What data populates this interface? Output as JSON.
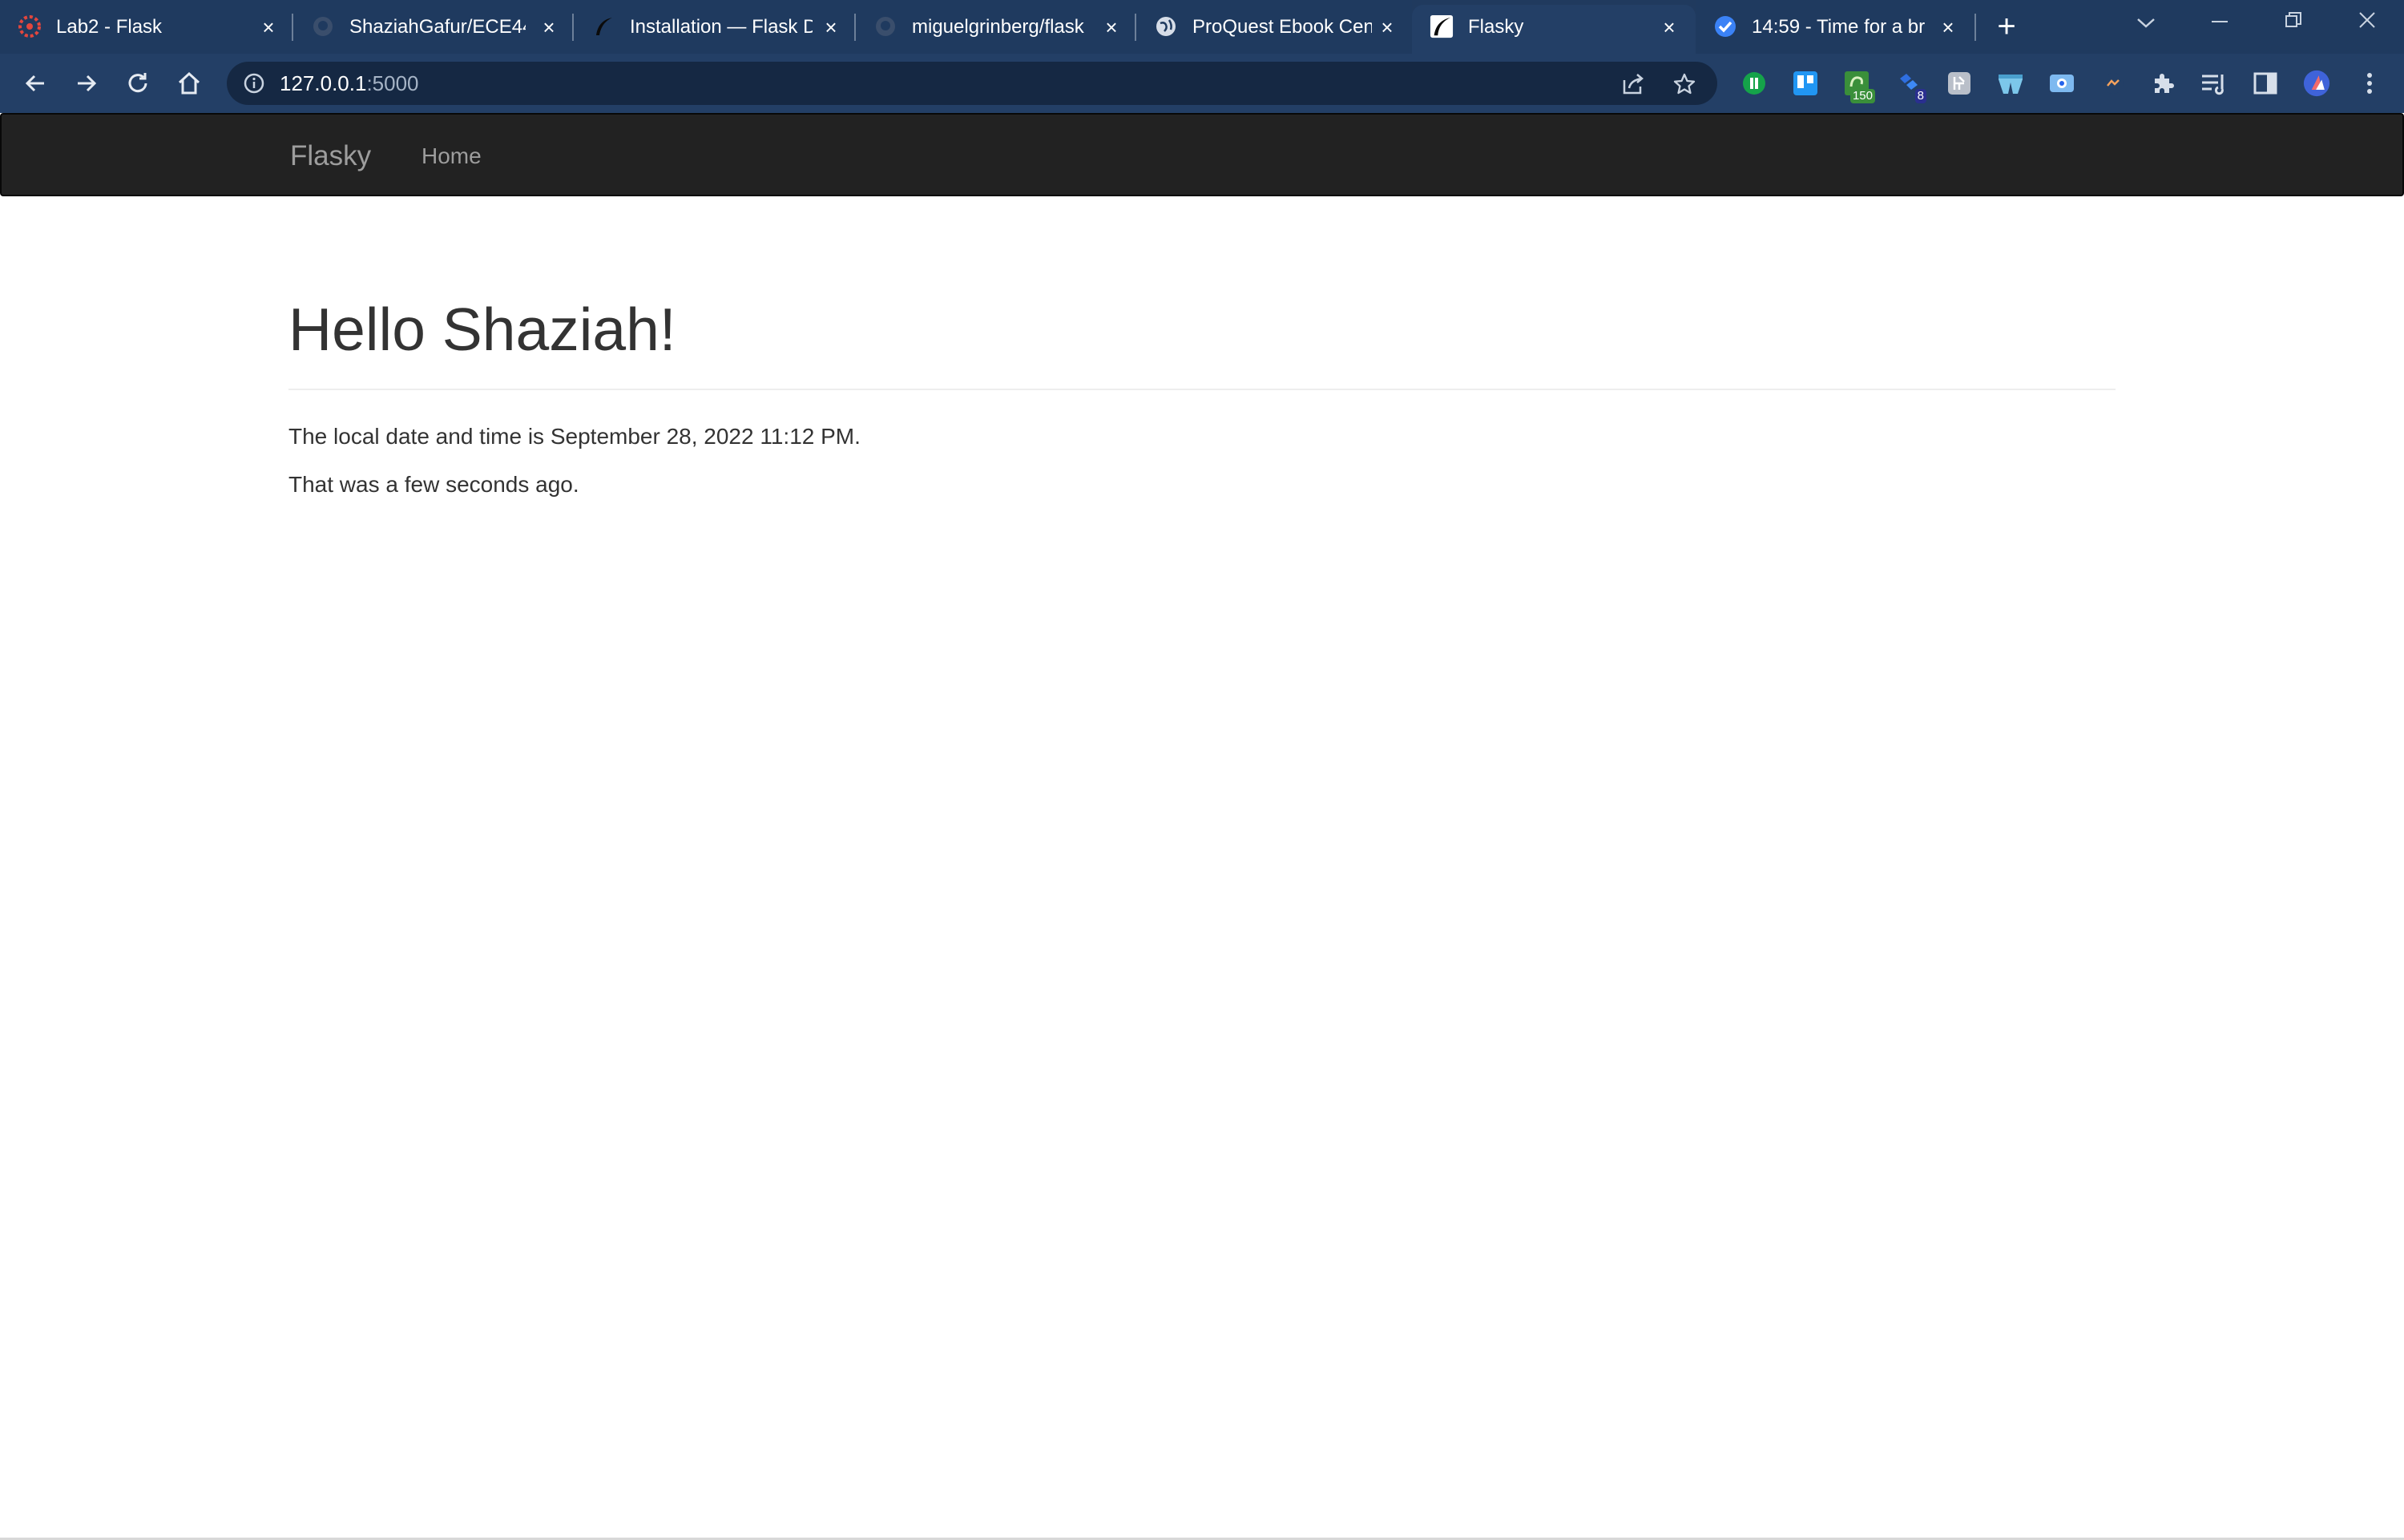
{
  "browser": {
    "tabs": [
      {
        "title": "Lab2 - Flask",
        "favicon": "canvas-icon"
      },
      {
        "title": "ShaziahGafur/ECE444",
        "favicon": "github-icon"
      },
      {
        "title": "Installation — Flask D",
        "favicon": "flask-icon"
      },
      {
        "title": "miguelgrinberg/flask",
        "favicon": "github-icon"
      },
      {
        "title": "ProQuest Ebook Cen",
        "favicon": "globe-icon"
      },
      {
        "title": "Flasky",
        "favicon": "flask-icon",
        "active": true
      },
      {
        "title": "14:59 - Time for a br",
        "favicon": "check-circle-icon"
      }
    ],
    "address": {
      "host": "127.0.0.1",
      "port": ":5000"
    },
    "extensions": [
      {
        "name": "grammarly-icon"
      },
      {
        "name": "trello-icon"
      },
      {
        "name": "counter-extension-icon",
        "badge": "150"
      },
      {
        "name": "puzzle-game-icon",
        "badge": "8"
      },
      {
        "name": "kanji-icon"
      },
      {
        "name": "shorts-icon"
      },
      {
        "name": "screenshot-icon"
      },
      {
        "name": "messenger-icon"
      },
      {
        "name": "extensions-icon"
      },
      {
        "name": "reading-list-icon"
      },
      {
        "name": "side-panel-icon"
      },
      {
        "name": "profile-avatar"
      },
      {
        "name": "menu-icon"
      }
    ],
    "colors": {
      "frame": "#1f3a5f",
      "toolbar": "#233f66",
      "omnibox": "#152843"
    }
  },
  "page": {
    "navbar": {
      "brand": "Flasky",
      "links": [
        "Home"
      ]
    },
    "greeting": "Hello Shaziah!",
    "datetime_line": "The local date and time is September 28, 2022 11:12 PM.",
    "relative_line": "That was a few seconds ago."
  }
}
